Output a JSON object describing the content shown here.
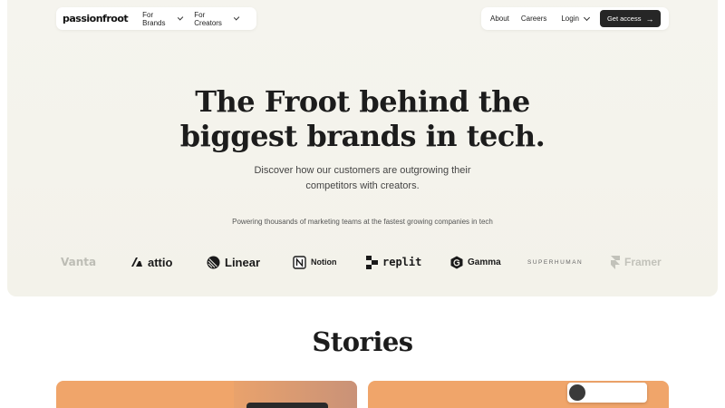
{
  "nav": {
    "logo": "passionfroot",
    "menus": [
      "For Brands",
      "For Creators"
    ],
    "links": [
      "About",
      "Careers"
    ],
    "login": "Login",
    "cta": "Get access"
  },
  "hero": {
    "headline_line1": "The Froot behind the",
    "headline_line2": "biggest brands in tech.",
    "subtitle_line1": "Discover how our customers are outgrowing their",
    "subtitle_line2": "competitors with creators.",
    "powering": "Powering thousands of marketing teams at the fastest growing companies in tech"
  },
  "logos": [
    "Vanta",
    "attio",
    "Linear",
    "Notion",
    "replit",
    "Gamma",
    "SUPERHUMAN",
    "Framer"
  ],
  "stories": {
    "title": "Stories"
  },
  "colors": {
    "cta_bg": "#262626",
    "hero_bg": "#f4f3ec",
    "card_bg": "#f0a56a"
  }
}
